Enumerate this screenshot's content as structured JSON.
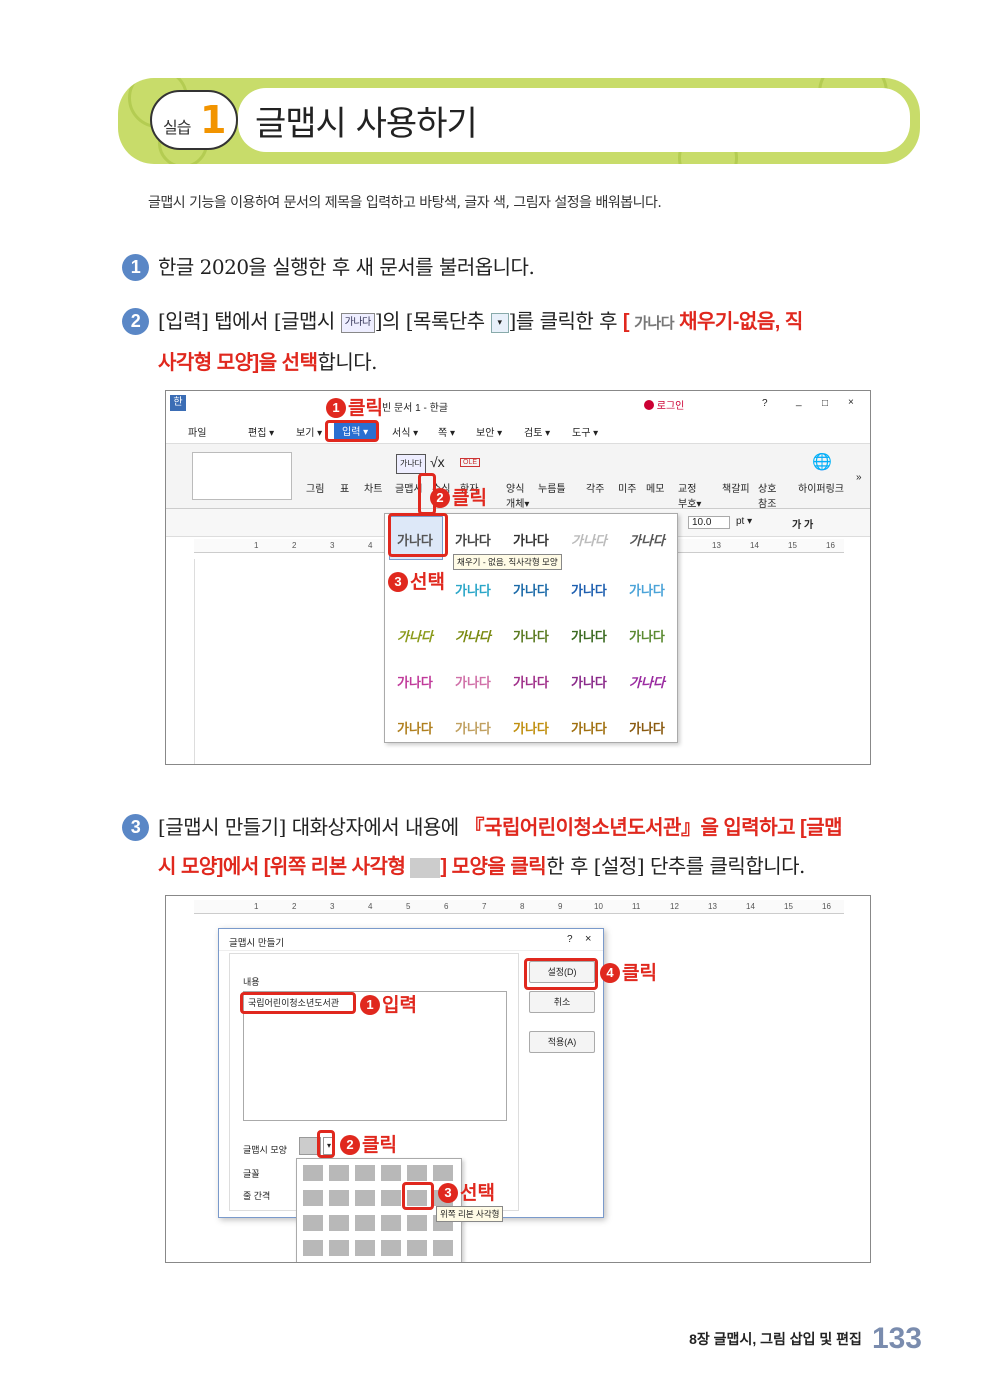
{
  "banner": {
    "label_small": "실습",
    "label_num": "1",
    "title": "글맵시 사용하기"
  },
  "intro": "글맵시 기능을 이용하여 문서의 제목을 입력하고 바탕색, 글자 색, 그림자 설정을 배워봅니다.",
  "steps": [
    {
      "num": "1",
      "text": "한글 2020을 실행한 후 새 문서를 불러옵니다."
    },
    {
      "num": "2",
      "t1": "[입력] 탭에서 [글맵시 ",
      "icon1": "가나다",
      "t2": "]의 [목록단추 ",
      "icon2": "▾",
      "t3": "]를 클릭한 후 ",
      "red1": "[ ",
      "wordart": "가나다",
      "red2": " 채우기-없음, 직",
      "red3": "사각형 모양]을 선택",
      "t4": "합니다."
    },
    {
      "num": "3",
      "t1": "[글맵시 만들기] 대화상자에서 내용에 ",
      "red1": "『국립어린이청소년도서관』을 입력하고 [글맵",
      "red2": "시 모양]에서 [위쪽 리본 사각형 ",
      "red3": "] 모양을 클릭",
      "t2": "한 후 [설정] 단추를 클릭합니다."
    }
  ],
  "screenshot1": {
    "app_icon": "한",
    "window_title": "빈 문서 1 - 한글",
    "login": "로그인",
    "win_controls": [
      "?",
      "_",
      "□",
      "×"
    ],
    "menu": [
      "파일",
      "편집 ▾",
      "보기 ▾",
      "입력 ▾",
      "서식 ▾",
      "쪽 ▾",
      "보안 ▾",
      "검토 ▾",
      "도구 ▾"
    ],
    "ribbon_items": [
      "그림",
      "표",
      "차트",
      "글맵시",
      "수식",
      "한자",
      "양식 개체▾",
      "누름틀",
      "각주",
      "미주",
      "메모",
      "교정 부호▾",
      "책갈피",
      "상호 참조",
      "하이퍼링크"
    ],
    "glyph_labels": {
      "wordart": "가나다",
      "formula": "√x",
      "ole": "OLE",
      "hyperlink": "🌐",
      "more": "»"
    },
    "font_size": "10.0",
    "unit": "pt ▾",
    "font_style": "가 가",
    "ruler_ticks": [
      "1",
      "2",
      "3",
      "4",
      "13",
      "14",
      "15",
      "16"
    ],
    "gallery_items": [
      "가나다",
      "가나다",
      "가나다",
      "가나다",
      "가나다",
      "가나다",
      "가나다",
      "가나다",
      "가나다",
      "가나다",
      "가나다",
      "가나다",
      "가나다",
      "가나다",
      "가나다",
      "가나다",
      "가나다",
      "가나다",
      "가나다",
      "가나다",
      "가나다",
      "가나다",
      "가나다",
      "가나다"
    ],
    "tooltip": "채우기 - 없음, 직사각형 모양",
    "callouts": [
      {
        "n": "1",
        "text": "클릭"
      },
      {
        "n": "2",
        "text": "클릭"
      },
      {
        "n": "3",
        "text": "선택"
      }
    ]
  },
  "screenshot2": {
    "ruler_ticks": [
      "1",
      "2",
      "3",
      "4",
      "5",
      "6",
      "7",
      "8",
      "9",
      "10",
      "11",
      "12",
      "13",
      "14",
      "15",
      "16"
    ],
    "dialog_title": "글맵시 만들기",
    "dialog_controls": [
      "?",
      "×"
    ],
    "content_label": "내용",
    "content_value": "국립어린이청소년도서관",
    "shape_label": "글맵시 모양",
    "font_label": "글꼴",
    "spacing_label": "줄 간격",
    "buttons": [
      "설정(D)",
      "취소",
      "적용(A)"
    ],
    "tooltip": "위쪽 리본 사각형",
    "callouts": [
      {
        "n": "1",
        "text": "입력"
      },
      {
        "n": "2",
        "text": "클릭"
      },
      {
        "n": "3",
        "text": "선택"
      },
      {
        "n": "4",
        "text": "클릭"
      }
    ]
  },
  "footer": {
    "chapter": "8장  글맵시, 그림 삽입 및 편집",
    "page": "133"
  }
}
